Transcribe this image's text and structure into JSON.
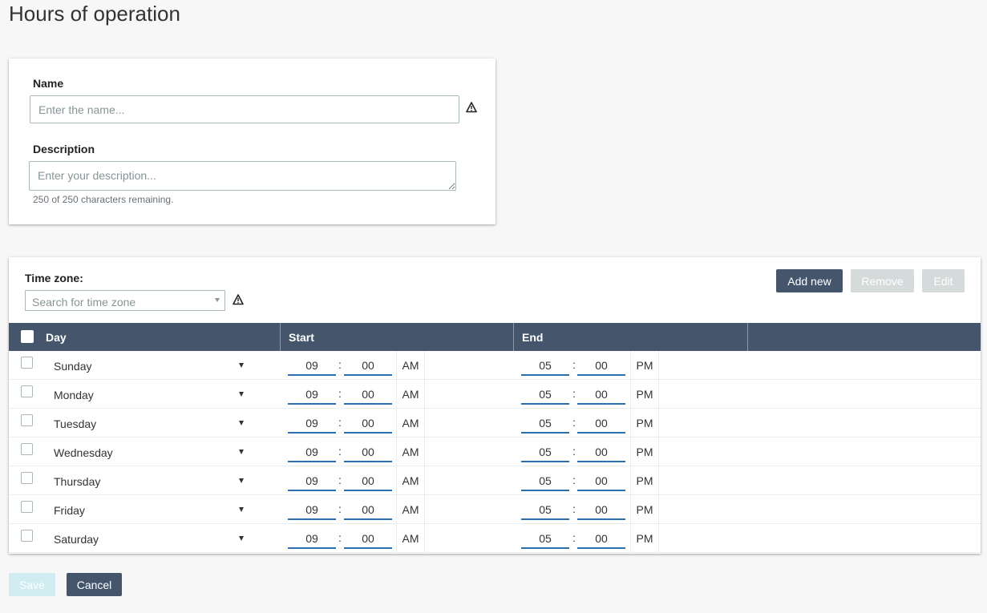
{
  "page_title": "Hours of operation",
  "name_field": {
    "label": "Name",
    "placeholder": "Enter the name..."
  },
  "description_field": {
    "label": "Description",
    "placeholder": "Enter your description...",
    "hint": "250 of 250 characters remaining."
  },
  "time_zone": {
    "label": "Time zone:",
    "placeholder": "Search for time zone"
  },
  "actions": {
    "add_new": "Add new",
    "remove": "Remove",
    "edit": "Edit"
  },
  "table": {
    "headers": {
      "day": "Day",
      "start": "Start",
      "end": "End"
    },
    "rows": [
      {
        "day": "Sunday",
        "start_h": "09",
        "start_m": "00",
        "start_ampm": "AM",
        "end_h": "05",
        "end_m": "00",
        "end_ampm": "PM"
      },
      {
        "day": "Monday",
        "start_h": "09",
        "start_m": "00",
        "start_ampm": "AM",
        "end_h": "05",
        "end_m": "00",
        "end_ampm": "PM"
      },
      {
        "day": "Tuesday",
        "start_h": "09",
        "start_m": "00",
        "start_ampm": "AM",
        "end_h": "05",
        "end_m": "00",
        "end_ampm": "PM"
      },
      {
        "day": "Wednesday",
        "start_h": "09",
        "start_m": "00",
        "start_ampm": "AM",
        "end_h": "05",
        "end_m": "00",
        "end_ampm": "PM"
      },
      {
        "day": "Thursday",
        "start_h": "09",
        "start_m": "00",
        "start_ampm": "AM",
        "end_h": "05",
        "end_m": "00",
        "end_ampm": "PM"
      },
      {
        "day": "Friday",
        "start_h": "09",
        "start_m": "00",
        "start_ampm": "AM",
        "end_h": "05",
        "end_m": "00",
        "end_ampm": "PM"
      },
      {
        "day": "Saturday",
        "start_h": "09",
        "start_m": "00",
        "start_ampm": "AM",
        "end_h": "05",
        "end_m": "00",
        "end_ampm": "PM"
      }
    ]
  },
  "footer": {
    "save": "Save",
    "cancel": "Cancel"
  },
  "colors": {
    "primary": "#44556c",
    "disabled": "#d5dbdb",
    "save_disabled": "#d1ecf1",
    "underline": "#2a6fb0"
  }
}
